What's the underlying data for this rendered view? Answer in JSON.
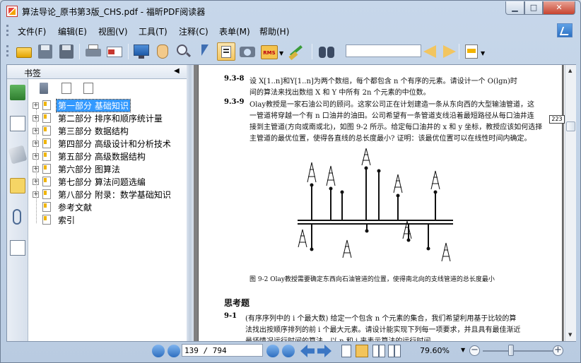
{
  "window": {
    "title": "算法导论_原书第3版_CHS.pdf - 福昕PDF阅读器",
    "min_glyph": "▁",
    "max_glyph": "□",
    "close_glyph": "✕"
  },
  "menu": [
    "文件(F)",
    "编辑(E)",
    "视图(V)",
    "工具(T)",
    "注释(C)",
    "表单(M)",
    "帮助(H)"
  ],
  "toolbar": {
    "search_value": "",
    "rms_label": "RMS"
  },
  "panel": {
    "title": "书签",
    "collapse_glyph": "◀"
  },
  "bookmarks": [
    {
      "label": "第一部分 基础知识",
      "expandable": true,
      "selected": true
    },
    {
      "label": "第二部分 排序和顺序统计量",
      "expandable": true
    },
    {
      "label": "第三部分 数据结构",
      "expandable": true
    },
    {
      "label": "第四部分 高级设计和分析技术",
      "expandable": true
    },
    {
      "label": "第五部分 高级数据结构",
      "expandable": true
    },
    {
      "label": "第六部分 图算法",
      "expandable": true
    },
    {
      "label": "第七部分 算法问题选编",
      "expandable": true
    },
    {
      "label": "第八部分 附录：数学基础知识",
      "expandable": true
    },
    {
      "label": "参考文献",
      "expandable": false
    },
    {
      "label": "索引",
      "expandable": false
    }
  ],
  "document": {
    "ex938_num": "9.3-8",
    "ex938_line1": "设 X[1..n]和Y[1..n]为两个数组，每个都包含 n 个有序的元素。请设计一个 O(lgn)时",
    "ex938_line2": "间的算法来找出数组 X 和 Y 中所有 2n 个元素的中位数。",
    "ex939_num": "9.3-9",
    "ex939_line1": "Olay教授是一家石油公司的顾问。这家公司正在计划建造一条从东向西的大型输油管道，这",
    "ex939_line2": "一管道将穿越一个有 n 口油井的油田。公司希望有一条管道支线沿着最短路径从每口油井连",
    "ex939_line3": "接到主管道(方向或南或北)，如图 9-2 所示。给定每口油井的 x 和 y 坐标，教授应该如何选择",
    "ex939_line4": "主管道的最优位置，使得各直线的总长度最小? 证明：该最优位置可以在线性时间内确定。",
    "margin_note": "223",
    "figure_caption": "图 9-2   Olay教授需要确定东西向石油管道的位置，使得南北向的支线管道的总长度最小",
    "section_title": "思考题",
    "p91_num": "9-1",
    "p91_line1": "(有序序列中的 i 个最大数)  给定一个包含 n 个元素的集合，我们希望利用基于比较的算",
    "p91_line2": "法找出按顺序排列的前 i 个最大元素。请设计能实现下列每一项要求，并且具有最佳渐近",
    "p91_line3": "最坏情况运行时间的算法，以 n 和 i 来表示算法的运行时间。"
  },
  "status": {
    "page_value": "139 / 794",
    "zoom": "79.60%",
    "zoom_fraction": 0.4,
    "minus": "−",
    "plus": "+"
  },
  "colors": {
    "accent": "#3b76c4",
    "selection": "#3399ff",
    "folder": "#f0b400"
  },
  "icons": [
    "open-folder-icon",
    "save-icon",
    "save-as-icon",
    "print-icon",
    "email-icon",
    "fullscreen-icon",
    "hand-icon",
    "zoom-icon",
    "select-icon",
    "text-select-icon",
    "snapshot-icon",
    "rms-icon",
    "sign-icon",
    "binoculars-icon",
    "prev-result-icon",
    "next-result-icon",
    "highlight-icon"
  ]
}
